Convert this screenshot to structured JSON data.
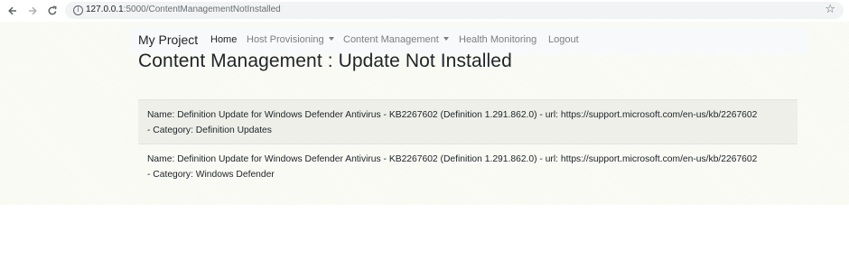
{
  "browser": {
    "url_host": "127.0.0.1",
    "url_rest": ":5000/ContentManagementNotInstalled",
    "icons": [
      "back-icon",
      "forward-icon",
      "reload-icon",
      "info-icon",
      "star-icon"
    ]
  },
  "navbar": {
    "brand": "My Project",
    "links": [
      {
        "label": "Home",
        "active": true,
        "dropdown": false
      },
      {
        "label": "Host Provisioning",
        "active": false,
        "dropdown": true
      },
      {
        "label": "Content Management",
        "active": false,
        "dropdown": true
      },
      {
        "label": "Health Monitoring",
        "active": false,
        "dropdown": false
      },
      {
        "label": "Logout",
        "active": false,
        "dropdown": false
      }
    ]
  },
  "main": {
    "title": "Content Management : Update Not Installed",
    "items": [
      {
        "line1": "Name: Definition Update for Windows Defender Antivirus - KB2267602 (Definition 1.291.862.0) - url: https://support.microsoft.com/en-us/kb/2267602",
        "line2": "- Category: Definition Updates"
      },
      {
        "line1": "Name: Definition Update for Windows Defender Antivirus - KB2267602 (Definition 1.291.862.0) - url: https://support.microsoft.com/en-us/kb/2267602",
        "line2": "- Category: Windows Defender"
      }
    ]
  },
  "colors": {
    "page_bg": "#fbfbf6",
    "navbar_bg": "#f8f9fa",
    "stripe_bg": "#efefea",
    "nav_link": "#7b7e82",
    "text": "#212529"
  }
}
